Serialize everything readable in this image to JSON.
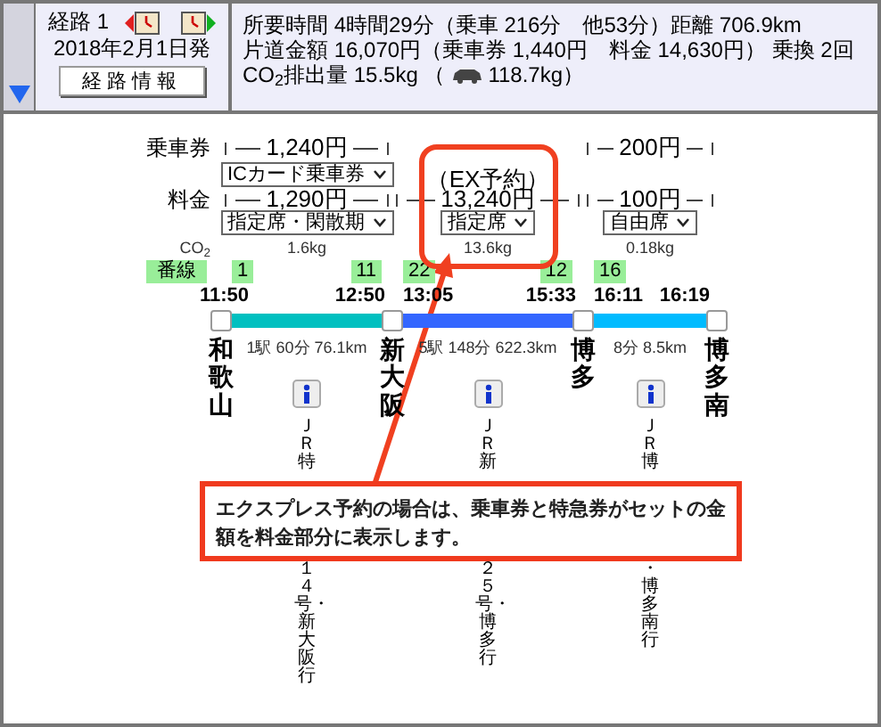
{
  "route": {
    "label": "経路 1",
    "date": "2018年2月1日発",
    "info_button": "経路情報"
  },
  "summary": {
    "line_1": "所要時間 4時間29分（乗車 216分　他53分）距離 706.9km",
    "line_2": "片道金額 16,070円（乗車券 1,440円　料金 14,630円） 乗換 2回",
    "co2": "CO$_{2}$排出量 15.5kg （",
    "car_co2": "118.7kg）"
  },
  "labels": {
    "ticket": "乗車券",
    "fare": "料金",
    "co2": "CO$_{2}$",
    "track": "番線"
  },
  "segments": [
    {
      "ticket": "1,240円",
      "ticket_option": "ICカード乗車券",
      "fare": "1,290円",
      "fare_option": "指定席・閑散期",
      "co2": "1.6kg",
      "dep_track": "1",
      "arr_track": "11",
      "dep_time": "11:50",
      "arr_time": "12:50",
      "color": "#00c0c0",
      "info": "1駅 60分 76.1km",
      "train_top": "ＪＲ特",
      "train_bottom": "１４号・新大阪行"
    },
    {
      "note": "（EX予約）",
      "fare": "13,240円",
      "fare_option": "指定席",
      "co2": "13.6kg",
      "dep_track": "22",
      "arr_track": "12",
      "dep_time": "13:05",
      "arr_time": "15:33",
      "color": "#3366ff",
      "info": "5駅 148分 622.3km",
      "train_top": "ＪＲ新",
      "train_bottom": "２５号・博多行"
    },
    {
      "ticket": "200円",
      "fare": "100円",
      "fare_option": "自由席",
      "co2": "0.18kg",
      "dep_track": "16",
      "dep_time": "16:11",
      "arr_time": "16:19",
      "color": "#00bbff",
      "info": "8分 8.5km",
      "train_top": "ＪＲ博",
      "train_bottom": "・博多南行"
    }
  ],
  "stations": [
    "和歌山",
    "新大阪",
    "博多",
    "博多南"
  ],
  "callout": "エクスプレス予約の場合は、乗車券と特急券がセットの金額を料金部分に表示します。"
}
